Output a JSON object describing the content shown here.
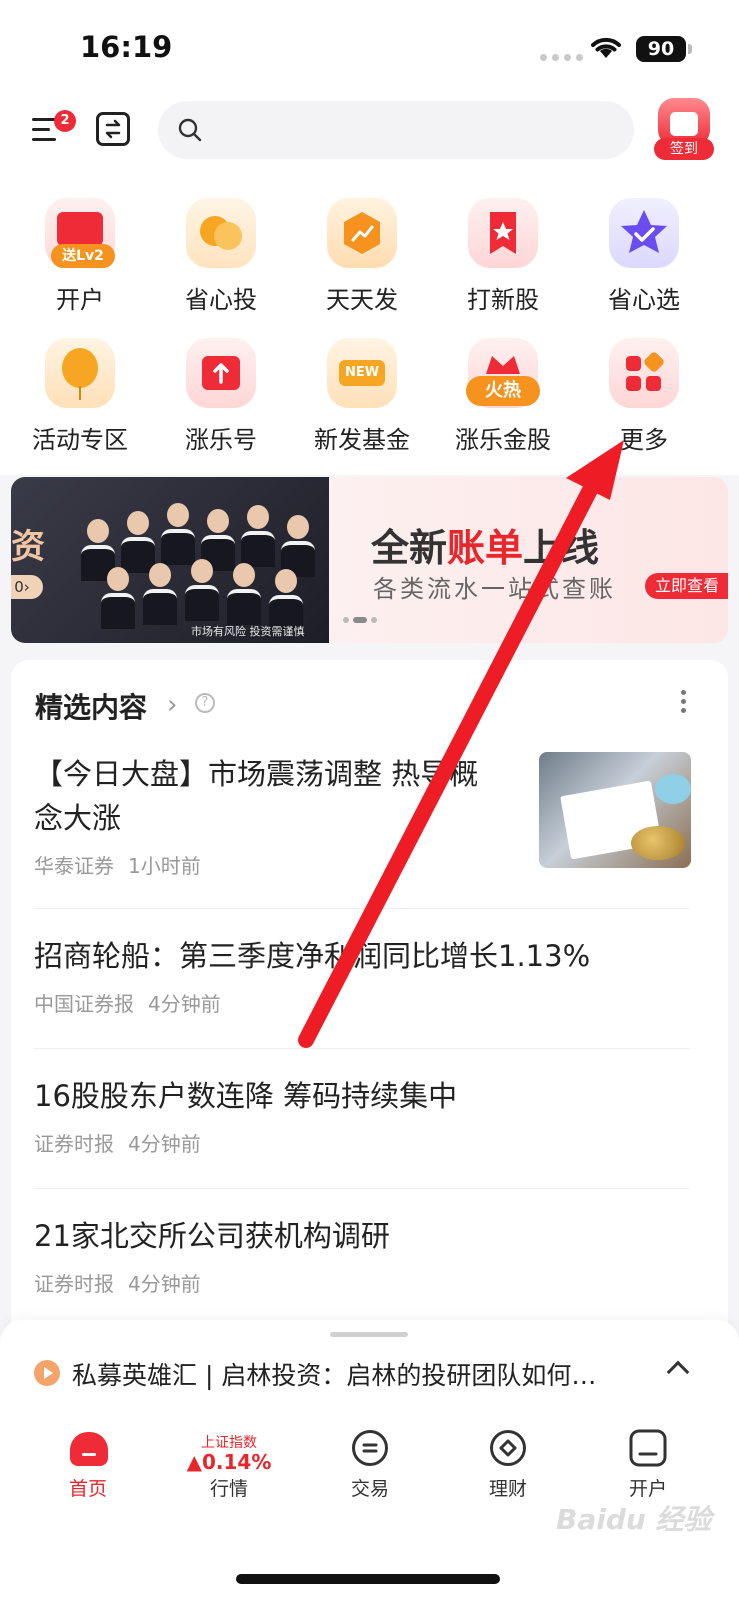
{
  "status_bar": {
    "time": "16:19",
    "battery": "90"
  },
  "header": {
    "menu_badge": "2",
    "search_placeholder": "",
    "checkin_label": "签到"
  },
  "shortcuts": [
    {
      "label": "开户",
      "badge": "送Lv2",
      "icon": "account-card-icon"
    },
    {
      "label": "省心投",
      "icon": "coins-icon"
    },
    {
      "label": "天天发",
      "icon": "hexagon-trend-icon"
    },
    {
      "label": "打新股",
      "icon": "bookmark-star-icon"
    },
    {
      "label": "省心选",
      "icon": "star-check-icon"
    },
    {
      "label": "活动专区",
      "icon": "balloon-icon"
    },
    {
      "label": "涨乐号",
      "icon": "upload-box-icon"
    },
    {
      "label": "新发基金",
      "badge": "NEW",
      "icon": "new-badge-icon"
    },
    {
      "label": "涨乐金股",
      "badge": "火热",
      "icon": "crown-icon"
    },
    {
      "label": "更多",
      "icon": "grid-more-icon"
    }
  ],
  "banner": {
    "left_text": "资",
    "left_pill": "0›",
    "caption": "市场有风险 投资需谨慎",
    "title_pre": "全新",
    "title_hl": "账单",
    "title_post": "上线",
    "subtitle": "各类流水一站式查账",
    "button": "立即查看"
  },
  "featured": {
    "title": "精选内容",
    "chevron": "›",
    "help": "?",
    "news": [
      {
        "title": "【今日大盘】市场震荡调整 热导概念大涨",
        "source": "华泰证券",
        "time": "1小时前"
      },
      {
        "title": "招商轮船：第三季度净利润同比增长1.13%",
        "source": "中国证券报",
        "time": "4分钟前"
      },
      {
        "title": "16股股东户数连降 筹码持续集中",
        "source": "证券时报",
        "time": "4分钟前"
      },
      {
        "title": "21家北交所公司获机构调研",
        "source": "证券时报",
        "time": "4分钟前"
      }
    ]
  },
  "ticker": {
    "text": "私募英雄汇 | 启林投资：启林的投研团队如何…"
  },
  "tabbar": {
    "tabs": [
      {
        "label": "首页"
      },
      {
        "label": "行情",
        "index_name": "上证指数",
        "index_value": "▲0.14%"
      },
      {
        "label": "交易"
      },
      {
        "label": "理财"
      },
      {
        "label": "开户"
      }
    ]
  },
  "watermark": "Baidu 经验",
  "colors": {
    "accent": "#ee2b36",
    "annotation_arrow": "#ee1c25"
  }
}
